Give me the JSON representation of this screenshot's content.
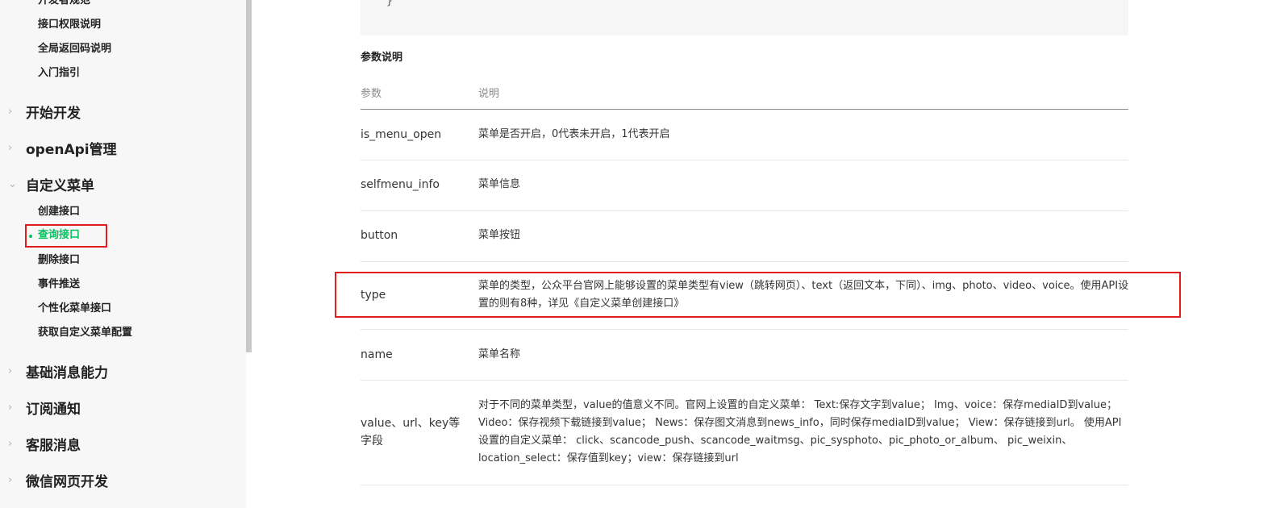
{
  "sidebar": {
    "top_items": [
      {
        "label": "开发者规范"
      },
      {
        "label": "接口权限说明"
      },
      {
        "label": "全局返回码说明"
      },
      {
        "label": "入门指引"
      }
    ],
    "sections": [
      {
        "label": "开始开发",
        "chevron": "›"
      },
      {
        "label": "openApi管理",
        "chevron": "›"
      },
      {
        "label": "自定义菜单",
        "chevron": "⌄"
      },
      {
        "label": "基础消息能力",
        "chevron": "›"
      },
      {
        "label": "订阅通知",
        "chevron": "›"
      },
      {
        "label": "客服消息",
        "chevron": "›"
      },
      {
        "label": "微信网页开发",
        "chevron": "›"
      }
    ],
    "menu_items": [
      {
        "label": "创建接口"
      },
      {
        "label": "查询接口"
      },
      {
        "label": "删除接口"
      },
      {
        "label": "事件推送"
      },
      {
        "label": "个性化菜单接口"
      },
      {
        "label": "获取自定义菜单配置"
      }
    ],
    "active_color": "#07c160"
  },
  "main": {
    "code_tail": "}",
    "section_title": "参数说明",
    "table": {
      "headers": [
        "参数",
        "说明"
      ],
      "rows": [
        {
          "param": "is_menu_open",
          "desc": "菜单是否开启，0代表未开启，1代表开启"
        },
        {
          "param": "selfmenu_info",
          "desc": "菜单信息"
        },
        {
          "param": "button",
          "desc": "菜单按钮"
        },
        {
          "param": "type",
          "desc": "菜单的类型，公众平台官网上能够设置的菜单类型有view（跳转网页）、text（返回文本，下同）、img、photo、video、voice。使用API设置的则有8种，详见《自定义菜单创建接口》"
        },
        {
          "param": "name",
          "desc": "菜单名称"
        },
        {
          "param": "value、url、key等字段",
          "desc": "对于不同的菜单类型，value的值意义不同。官网上设置的自定义菜单： Text:保存文字到value； Img、voice：保存mediaID到value； Video：保存视频下载链接到value； News：保存图文消息到news_info，同时保存mediaID到value； View：保存链接到url。 使用API设置的自定义菜单： click、scancode_push、scancode_waitmsg、pic_sysphoto、pic_photo_or_album、 pic_weixin、location_select：保存值到key；view：保存链接到url"
        }
      ]
    }
  },
  "highlight_color": "#e01c1c"
}
